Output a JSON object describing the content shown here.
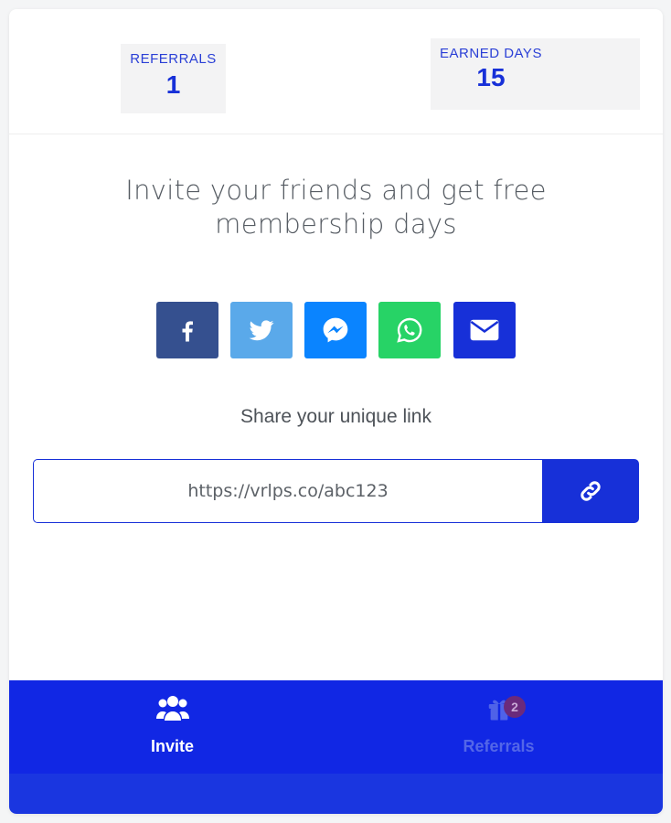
{
  "stats": {
    "referrals": {
      "label": "REFERRALS",
      "value": "1"
    },
    "earned_days": {
      "label": "EARNED DAYS",
      "value": "15"
    }
  },
  "headline": "Invite your friends and get free membership days",
  "share_buttons": [
    {
      "name": "facebook",
      "icon": "facebook-icon",
      "color": "#3b5998"
    },
    {
      "name": "twitter",
      "icon": "twitter-icon",
      "color": "#55acee"
    },
    {
      "name": "messenger",
      "icon": "messenger-icon",
      "color": "#0084ff"
    },
    {
      "name": "whatsapp",
      "icon": "whatsapp-icon",
      "color": "#25d366"
    },
    {
      "name": "email",
      "icon": "envelope-icon",
      "color": "#1730d8"
    }
  ],
  "share_link": {
    "label": "Share your unique link",
    "url": "https://vrlps.co/abc123",
    "copy_icon": "link-icon"
  },
  "bottom_nav": {
    "tabs": [
      {
        "label": "Invite",
        "icon": "users-icon",
        "active": true
      },
      {
        "label": "Referrals",
        "icon": "gift-icon",
        "active": false,
        "badge": "2"
      }
    ],
    "bg_color": "#1127e4"
  },
  "colors": {
    "accent": "#1730d8",
    "stat_bg": "#f3f3f4"
  }
}
